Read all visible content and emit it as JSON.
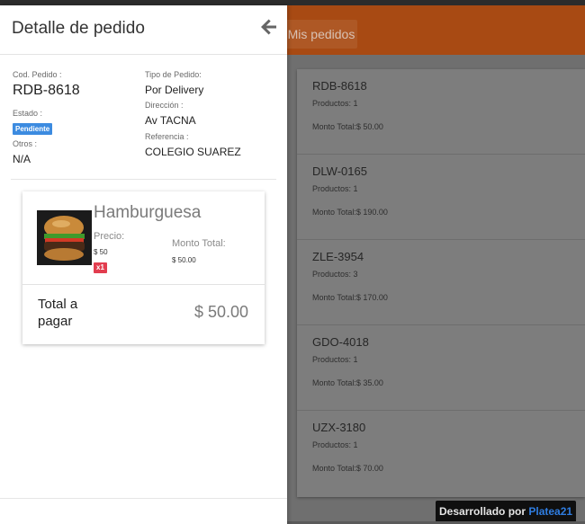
{
  "appbar": {
    "nav_label": "Mis pedidos"
  },
  "orders": [
    {
      "code": "RDB-8618",
      "products": "Productos: 1",
      "total": "Monto Total:$ 50.00"
    },
    {
      "code": "DLW-0165",
      "products": "Productos: 1",
      "total": "Monto Total:$ 190.00"
    },
    {
      "code": "ZLE-3954",
      "products": "Productos: 3",
      "total": "Monto Total:$ 170.00"
    },
    {
      "code": "GDO-4018",
      "products": "Productos: 1",
      "total": "Monto Total:$ 35.00"
    },
    {
      "code": "UZX-3180",
      "products": "Productos: 1",
      "total": "Monto Total:$ 70.00"
    }
  ],
  "credit": {
    "prefix": "Desarrollado por",
    "brand": "Platea21"
  },
  "detail": {
    "title": "Detalle de pedido",
    "cod_label": "Cod. Pedido :",
    "cod_value": "RDB-8618",
    "estado_label": "Estado :",
    "estado_value": "Pendiente",
    "otros_label": "Otros :",
    "otros_value": "N/A",
    "tipo_label": "Tipo de Pedido:",
    "tipo_value": "Por Delivery",
    "direccion_label": "Dirección :",
    "direccion_value": "Av TACNA",
    "referencia_label": "Referencia :",
    "referencia_value": "COLEGIO SUAREZ"
  },
  "item": {
    "name": "Hamburguesa",
    "price_label": "Precio:",
    "price_value": "$ 50",
    "qty": "x1",
    "monto_label": "Monto Total:",
    "monto_value": "$ 50.00"
  },
  "totals": {
    "label": "Total a pagar",
    "value": "$ 50.00"
  },
  "colors": {
    "accent": "#e8651c",
    "badge_blue": "#3c8be0",
    "badge_red": "#e23d4f"
  },
  "icons": {
    "back": "arrow-left-icon"
  }
}
